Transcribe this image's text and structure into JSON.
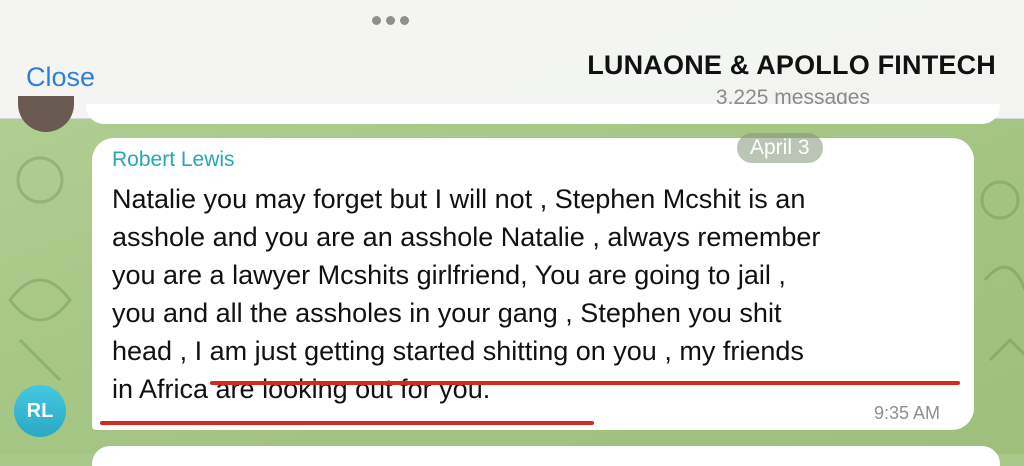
{
  "header": {
    "close_label": "Close",
    "title": "LUNAONE & APOLLO FINTECH",
    "subtitle": "3,225 messages"
  },
  "message": {
    "sender": "Robert Lewis",
    "avatar_initials": "RL",
    "date": "April 3",
    "lines": [
      "Natalie you may forget but I will not , Stephen Mcshit is an",
      "asshole and you are an asshole Natalie , always remember",
      "you are a lawyer Mcshits girlfriend, You are going to jail ,",
      "you and all the assholes in your gang , Stephen you shit",
      "head , I am just getting started shitting on you , my friends",
      "in Africa are looking out for you."
    ],
    "time": "9:35 AM"
  },
  "colors": {
    "accent_blue": "#2f7fd9",
    "sender_teal": "#27a6b8",
    "underline_red": "#d5291f",
    "chat_background": "#a9c98a"
  }
}
